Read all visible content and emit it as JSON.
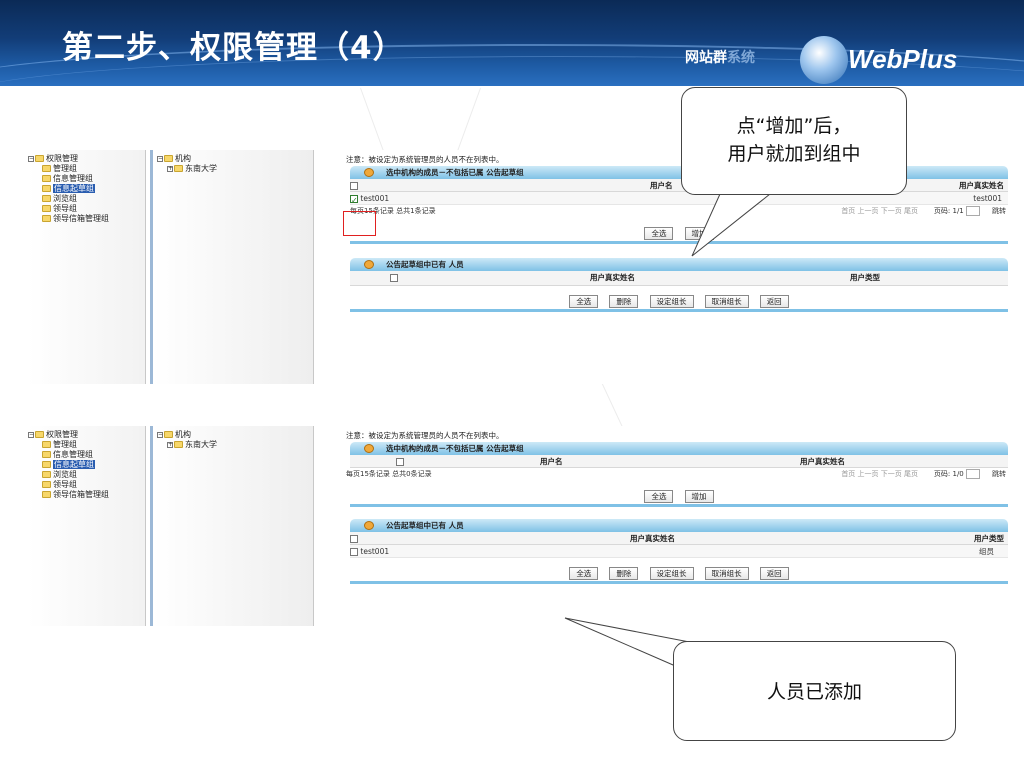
{
  "slide": {
    "title": "第二步、权限管理（4）",
    "brand_text": "网站群",
    "brand_suffix": "系统",
    "brand_logo": "WebPlus"
  },
  "tree": {
    "items": [
      {
        "label": "权限管理",
        "level": 0,
        "expander": "−",
        "selected": false
      },
      {
        "label": "管理组",
        "level": 1,
        "selected": false
      },
      {
        "label": "信息管理组",
        "level": 1,
        "selected": false
      },
      {
        "label": "信息起草组",
        "level": 1,
        "selected": true
      },
      {
        "label": "浏览组",
        "level": 1,
        "selected": false
      },
      {
        "label": "领导组",
        "level": 1,
        "selected": false
      },
      {
        "label": "领导信箱管理组",
        "level": 1,
        "selected": false
      }
    ]
  },
  "org_tree": {
    "root": "机构",
    "root_expander": "−",
    "child": "东南大学",
    "child_expander": "+"
  },
  "panel1": {
    "note": "注意：被设定为系统管理员的人员不在列表中。",
    "members_header": "选中机构的成员－不包括已属 公告起草组",
    "col_username": "用户名",
    "col_realname": "用户真实姓名",
    "row_user": "test001",
    "row_realname": "test001",
    "pager_left": "每页15条记录 总共1条记录",
    "pager_links": "首页 上一页 下一页 尾页",
    "pager_page": "页码: 1/1",
    "pager_jump": "跳转",
    "btn_select_all": "全选",
    "btn_add": "增加",
    "group_header": "公告起草组中已有 人员",
    "col_realname2": "用户真实姓名",
    "col_usertype": "用户类型",
    "btn_select_all2": "全选",
    "btn_delete": "删除",
    "btn_set_leader": "设定组长",
    "btn_cancel_leader": "取消组长",
    "btn_back": "返回"
  },
  "panel2": {
    "note": "注意：被设定为系统管理员的人员不在列表中。",
    "members_header": "选中机构的成员－不包括已属 公告起草组",
    "col_username": "用户名",
    "col_realname": "用户真实姓名",
    "pager_left": "每页15条记录 总共0条记录",
    "pager_links": "首页 上一页 下一页 尾页",
    "pager_page": "页码: 1/0",
    "pager_jump": "跳转",
    "btn_select_all": "全选",
    "btn_add": "增加",
    "group_header": "公告起草组中已有 人员",
    "col_realname2": "用户真实姓名",
    "col_usertype": "用户类型",
    "row_user": "test001",
    "row_usertype": "组员",
    "btn_select_all2": "全选",
    "btn_delete": "删除",
    "btn_set_leader": "设定组长",
    "btn_cancel_leader": "取消组长",
    "btn_back": "返回"
  },
  "callouts": {
    "first_line1": "点“增加”后，",
    "first_line2": "用户就加到组中",
    "second": "人员已添加"
  },
  "colors": {
    "banner": "#123d78",
    "panel_header": "#7fc1e6",
    "selection": "#2a5db0",
    "highlight_box": "#e02020"
  }
}
